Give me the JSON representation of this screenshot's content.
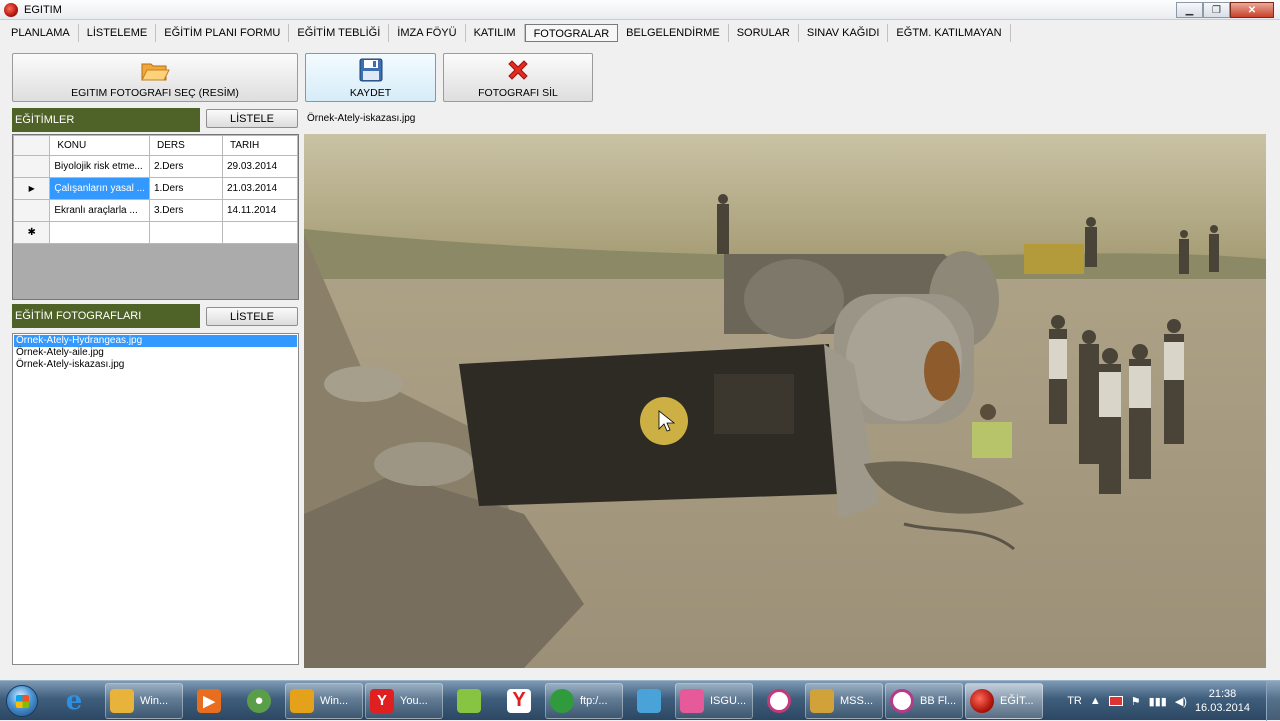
{
  "window": {
    "title": "EGITIM"
  },
  "menu": [
    {
      "label": "PLANLAMA"
    },
    {
      "label": "LİSTELEME"
    },
    {
      "label": "EĞİTİM PLANI FORMU"
    },
    {
      "label": "EĞİTİM TEBLİĞİ"
    },
    {
      "label": "İMZA FÖYÜ"
    },
    {
      "label": "KATILIM"
    },
    {
      "label": "FOTOGRALAR"
    },
    {
      "label": "BELGELENDİRME"
    },
    {
      "label": "SORULAR"
    },
    {
      "label": "SINAV KAĞIDI"
    },
    {
      "label": "EĞTM. KATILMAYAN"
    }
  ],
  "toolbar": {
    "select_label": "EGITIM FOTOGRAFI SEÇ (RESİM)",
    "save_label": "KAYDET",
    "delete_label": "FOTOGRAFI SİL"
  },
  "trainings": {
    "header": "EĞİTİMLER",
    "list_button": "LİSTELE",
    "columns": [
      "KONU",
      "DERS",
      "TARIH"
    ],
    "rows": [
      {
        "konu": "Biyolojik risk etme...",
        "ders": "2.Ders",
        "tarih": "29.03.2014"
      },
      {
        "konu": "Çalışanların yasal ...",
        "ders": "1.Ders",
        "tarih": "21.03.2014"
      },
      {
        "konu": "Ekranlı araçlarla ...",
        "ders": "3.Ders",
        "tarih": "14.11.2014"
      }
    ],
    "current_row_marker": "▶",
    "new_row_marker": "✱"
  },
  "photos": {
    "header": "EĞİTİM FOTOGRAFLARI",
    "list_button": "LİSTELE",
    "files": [
      "Örnek-Ately-Hydrangeas.jpg",
      "Örnek-Ately-aile.jpg",
      "Örnek-Ately-iskazası.jpg"
    ],
    "selected_index": 0
  },
  "preview": {
    "filename": "Örnek-Ately-iskazası.jpg"
  },
  "taskbar": {
    "items": [
      {
        "label": "Win...",
        "icon": "folder-icon",
        "color": "#e8b33a"
      },
      {
        "label": "",
        "icon": "media-player-icon",
        "color": "#e86d1f"
      },
      {
        "label": "",
        "icon": "disc-icon",
        "color": "#5b9e4a"
      },
      {
        "label": "Win...",
        "icon": "puzzle-icon",
        "color": "#e3a21a"
      },
      {
        "label": "You...",
        "icon": "yandex-icon",
        "color": "#e02020"
      },
      {
        "label": "",
        "icon": "sticky-notes-icon",
        "color": "#86c441"
      },
      {
        "label": "",
        "icon": "yandex-browser-icon",
        "color": "#e02020"
      },
      {
        "label": "ftp:/...",
        "icon": "ftp-icon",
        "color": "#2f9b3c"
      },
      {
        "label": "",
        "icon": "stack-icon",
        "color": "#4aa3d8"
      },
      {
        "label": "ISGU...",
        "icon": "isgu-icon",
        "color": "#e65a9a"
      },
      {
        "label": "",
        "icon": "speedometer-icon",
        "color": "#c23a7a"
      },
      {
        "label": "MSS...",
        "icon": "mss-icon",
        "color": "#d1a23a"
      },
      {
        "label": "BB Fl...",
        "icon": "flashback-icon",
        "color": "#b53a8a"
      },
      {
        "label": "EĞİT...",
        "icon": "egitim-app-icon",
        "color": "#c01a10"
      }
    ],
    "language": "TR",
    "time": "21:38",
    "date": "16.03.2014"
  }
}
